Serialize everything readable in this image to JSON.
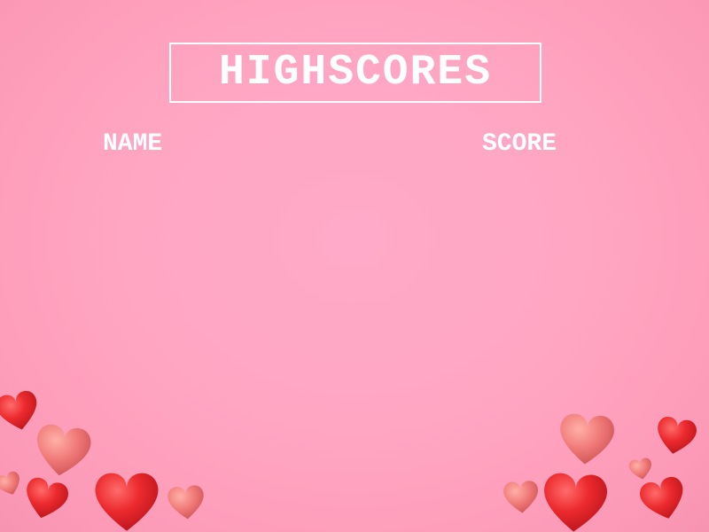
{
  "screen": {
    "title": "HIGHSCORES",
    "columns": {
      "name_label": "NAME",
      "score_label": "SCORE"
    },
    "entries": []
  },
  "colors": {
    "background": "#ffa6c3",
    "text": "#ffffff",
    "heart_red": "#e8242a",
    "heart_salmon": "#f07a78"
  },
  "decorations": {
    "icon": "heart-icon"
  }
}
